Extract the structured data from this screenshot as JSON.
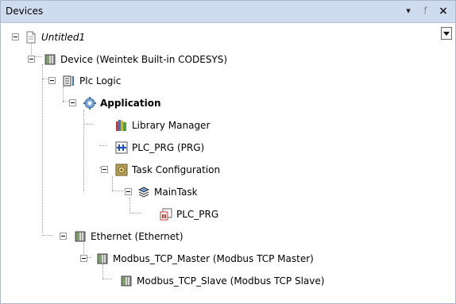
{
  "panel": {
    "title": "Devices",
    "btn_dropdown": "▾",
    "btn_pin": "ᚴ",
    "btn_close": "×"
  },
  "tree": {
    "nodes": [
      {
        "label": "Untitled1"
      },
      {
        "label": "Device (Weintek Built-in CODESYS)"
      },
      {
        "label": "Plc Logic"
      },
      {
        "label": "Application"
      },
      {
        "label": "Library Manager"
      },
      {
        "label": "PLC_PRG (PRG)"
      },
      {
        "label": "Task Configuration"
      },
      {
        "label": "MainTask"
      },
      {
        "label": "PLC_PRG"
      },
      {
        "label": "Ethernet (Ethernet)"
      },
      {
        "label": "Modbus_TCP_Master (Modbus TCP Master)"
      },
      {
        "label": "Modbus_TCP_Slave (Modbus TCP Slave)"
      }
    ]
  }
}
